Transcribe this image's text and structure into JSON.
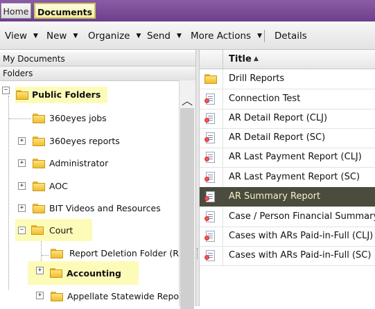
{
  "tabs": {
    "home": "Home",
    "documents": "Documents"
  },
  "toolbar": {
    "view": "View",
    "new": "New",
    "organize": "Organize",
    "send": "Send",
    "more_actions": "More Actions",
    "details": "Details"
  },
  "left_panel": {
    "my_documents": "My Documents",
    "folders": "Folders",
    "tree": {
      "public_folders": "Public Folders",
      "jobs_360eyes": "360eyes jobs",
      "reports_360eyes": "360eyes reports",
      "administrator": "Administrator",
      "aoc": "AOC",
      "bit_videos": "BIT Videos and Resources",
      "court": "Court",
      "report_deletion": "Report Deletion Folder (Re",
      "accounting": "Accounting",
      "appellate": "Appellate Statewide Reports"
    }
  },
  "list": {
    "column_title": "Title",
    "rows": [
      "Drill Reports",
      "Connection Test",
      "AR Detail Report (CLJ)",
      "AR Detail Report (SC)",
      "AR Last Payment Report (CLJ)",
      "AR Last Payment Report (SC)",
      "AR Summary Report",
      "Case / Person Financial Summary",
      "Cases with ARs Paid-in-Full (CLJ)",
      "Cases with ARs Paid-in-Full (SC)"
    ]
  },
  "colors": {
    "accent_purple": "#6d3f8c",
    "highlight": "#fdfbb8",
    "selected_row": "#4b4b3e"
  }
}
